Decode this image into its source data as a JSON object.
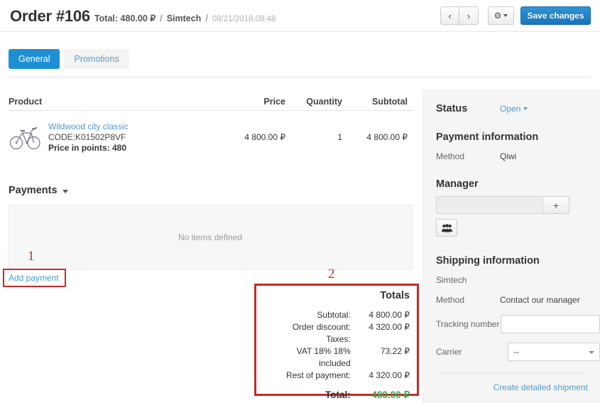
{
  "header": {
    "order_title": "Order #106",
    "total_label": "Total: 480.00 ₽",
    "separator": "/",
    "company": "Simtech",
    "separator2": "/",
    "date": "08/21/2018,08:48",
    "prev_icon": "‹",
    "next_icon": "›",
    "gear_icon": "⚙",
    "save_label": "Save changes"
  },
  "tabs": [
    {
      "label": "General",
      "active": true
    },
    {
      "label": "Promotions",
      "active": false
    }
  ],
  "products": {
    "columns": [
      "Product",
      "Price",
      "Quantity",
      "Subtotal"
    ],
    "rows": [
      {
        "name": "Wildwood city classic",
        "code": "CODE:K01502P8VF",
        "points": "Price in points: 480",
        "price": "4 800.00 ₽",
        "quantity": "1",
        "subtotal": "4 800.00 ₽"
      }
    ]
  },
  "payments": {
    "title": "Payments",
    "empty_text": "No items defined",
    "add_link": "Add payment"
  },
  "annotations": [
    {
      "label": "1"
    },
    {
      "label": "2"
    }
  ],
  "totals": {
    "title": "Totals",
    "rows": [
      {
        "label": "Subtotal:",
        "value": "4 800.00 ₽"
      },
      {
        "label": "Order discount:",
        "value": "4 320.00 ₽"
      },
      {
        "label": "Taxes:",
        "value": ""
      },
      {
        "label": "VAT 18% 18% included",
        "value": "73.22 ₽"
      },
      {
        "label": "Rest of payment:",
        "value": "4 320.00 ₽"
      }
    ],
    "total_label": "Total:",
    "total_value": "480.00 ₽",
    "total_color": "#3fa34a",
    "box_color": "#c42b2b"
  },
  "sidebar": {
    "status_title": "Status",
    "status_value": "Open",
    "payment_info_title": "Payment information",
    "payment_method_label": "Method",
    "payment_method_value": "Qiwi",
    "manager_title": "Manager",
    "manager_value": "",
    "manager_placeholder": "",
    "manager_add_icon": "+",
    "shipping_title": "Shipping information",
    "shipping_company": "Simtech",
    "shipping_method_label": "Method",
    "shipping_method_value": "Contact our manager",
    "tracking_label": "Tracking number",
    "tracking_value": "",
    "carrier_label": "Carrier",
    "carrier_value": "--",
    "create_shipment_link": "Create detailed shipment"
  },
  "colors": {
    "accent": "#1f8fd4",
    "link": "#4a9ad4",
    "annotation_red": "#c42b2b",
    "total_green": "#3fa34a"
  }
}
